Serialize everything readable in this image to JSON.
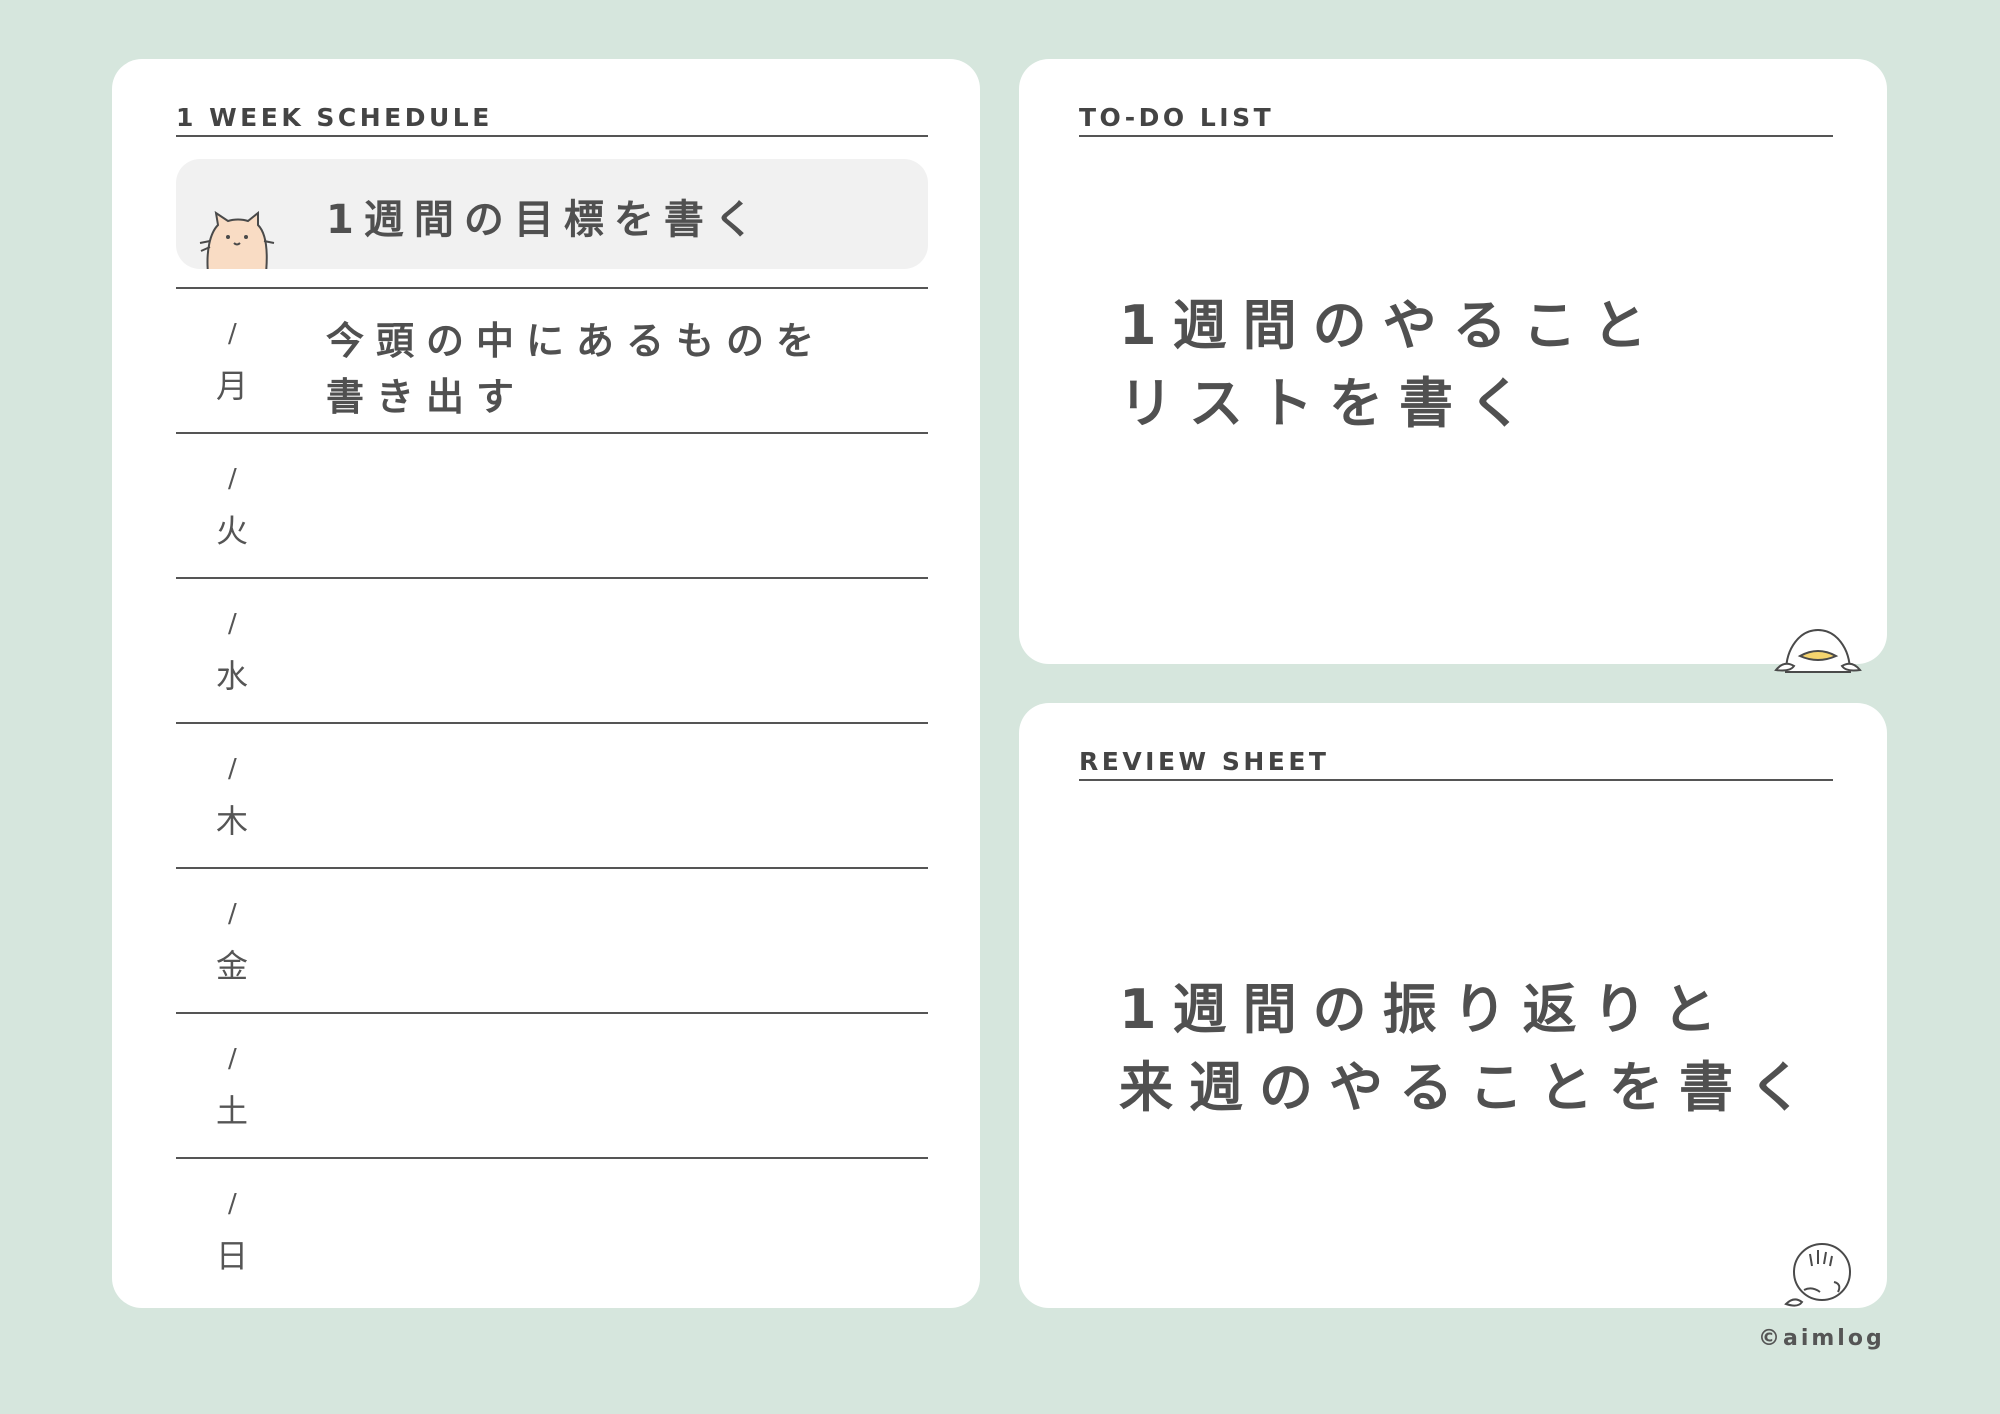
{
  "schedule": {
    "title": "1 WEEK SCHEDULE",
    "goal": "1週間の目標を書く",
    "days": [
      {
        "slash": "/",
        "name": "月",
        "note": "今頭の中にあるものを\n書き出す"
      },
      {
        "slash": "/",
        "name": "火",
        "note": ""
      },
      {
        "slash": "/",
        "name": "水",
        "note": ""
      },
      {
        "slash": "/",
        "name": "木",
        "note": ""
      },
      {
        "slash": "/",
        "name": "金",
        "note": ""
      },
      {
        "slash": "/",
        "name": "土",
        "note": ""
      },
      {
        "slash": "/",
        "name": "日",
        "note": ""
      }
    ]
  },
  "todo": {
    "title": "TO-DO LIST",
    "line1": "1週間のやること",
    "line2": "リストを書く"
  },
  "review": {
    "title": "REVIEW SHEET",
    "line1": "1週間の振り返りと",
    "line2": "来週のやることを書く"
  },
  "footer": {
    "copyright": "©aimlog"
  },
  "icons": [
    "cat-icon",
    "duck-icon",
    "boy-icon"
  ],
  "colors": {
    "background": "#d6e6dd",
    "card": "#ffffff",
    "goal_box": "#f1f1f1",
    "text": "#4a4a4a"
  }
}
